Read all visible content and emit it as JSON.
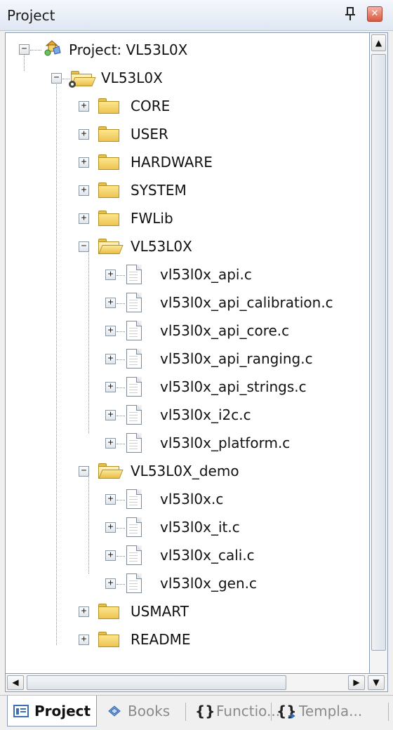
{
  "panel": {
    "title": "Project",
    "pin_glyph": "ᵽ",
    "close_glyph": "✕"
  },
  "tree": {
    "root": {
      "label": "Project: VL53L0X",
      "icon": "project-icon",
      "expander": "−"
    },
    "target": {
      "label": "VL53L0X",
      "icon": "target-folder-icon",
      "expander": "−"
    },
    "groups": [
      {
        "label": "CORE",
        "expander": "+"
      },
      {
        "label": "USER",
        "expander": "+"
      },
      {
        "label": "HARDWARE",
        "expander": "+"
      },
      {
        "label": "SYSTEM",
        "expander": "+"
      },
      {
        "label": "FWLib",
        "expander": "+"
      },
      {
        "label": "VL53L0X",
        "expander": "−"
      },
      {
        "label": "VL53L0X_demo",
        "expander": "−"
      },
      {
        "label": "USMART",
        "expander": "+"
      },
      {
        "label": "README",
        "expander": "+"
      }
    ],
    "vl53l0x_files": [
      "vl53l0x_api.c",
      "vl53l0x_api_calibration.c",
      "vl53l0x_api_core.c",
      "vl53l0x_api_ranging.c",
      "vl53l0x_api_strings.c",
      "vl53l0x_i2c.c",
      "vl53l0x_platform.c"
    ],
    "demo_files": [
      "vl53l0x.c",
      "vl53l0x_it.c",
      "vl53l0x_cali.c",
      "vl53l0x_gen.c"
    ],
    "file_expander": "+"
  },
  "scrollbar": {
    "up": "▲",
    "left": "◀",
    "right": "▶",
    "down": "▼"
  },
  "tabs": [
    {
      "label": "Project",
      "icon": "project-tab-icon",
      "active": true
    },
    {
      "label": "Books",
      "icon": "books-icon",
      "active": false
    },
    {
      "label": "Functio...",
      "icon": "braces-icon",
      "glyph": "{}",
      "active": false
    },
    {
      "label": "Templa...",
      "icon": "template-icon",
      "glyph": "{}",
      "active": false
    }
  ]
}
